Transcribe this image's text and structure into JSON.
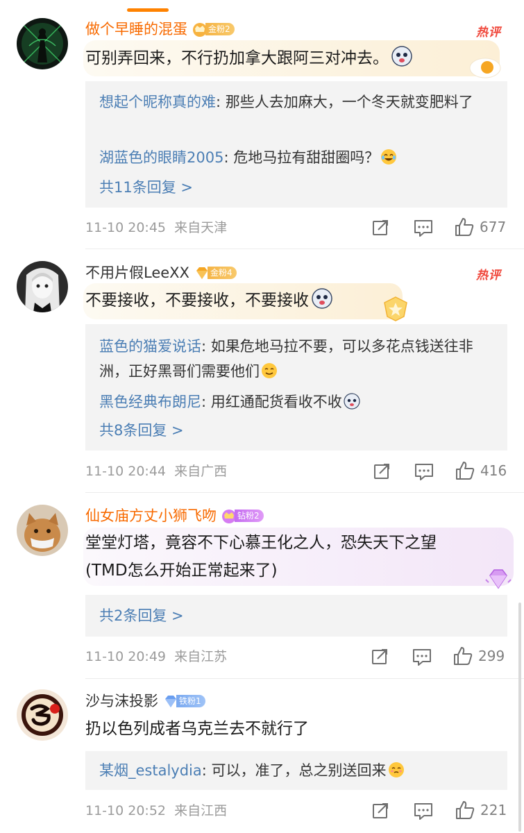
{
  "comments": [
    {
      "username": "做个早睡的混蛋",
      "badge": {
        "text": "金粉2",
        "type": "gold"
      },
      "hot_label": "热评",
      "text": "可别弄回来，不行扔加拿大跟阿三对冲去。",
      "replies": [
        {
          "user": "想起个昵称真的难",
          "text": ": 那些人去加麻大，一个冬天就变肥料了"
        },
        {
          "user": "湖蓝色的眼睛2005",
          "text": ": 危地马拉有甜甜圈吗？"
        }
      ],
      "more_replies": "共11条回复 >",
      "timestamp": "11-10 20:45",
      "location": "来自天津",
      "likes": "677"
    },
    {
      "username": "不用片假LeeXX",
      "badge": {
        "text": "金粉4",
        "type": "gold"
      },
      "hot_label": "热评",
      "text": "不要接收，不要接收，不要接收",
      "replies": [
        {
          "user": "蓝色的猫爱说话",
          "text": ": 如果危地马拉不要，可以多花点钱送往非洲，正好黑哥们需要他们"
        },
        {
          "user": "黑色经典布朗尼",
          "text": ": 用红通配货看收不收"
        }
      ],
      "more_replies": "共8条回复 >",
      "timestamp": "11-10 20:44",
      "location": "来自广西",
      "likes": "416"
    },
    {
      "username": "仙女庙方丈小狮飞吻",
      "badge": {
        "text": "钻粉2",
        "type": "diamond"
      },
      "text": "堂堂灯塔，竟容不下心慕王化之人，恐失天下之望(TMD怎么开始正常起来了)",
      "text_line1": "堂堂灯塔，竟容不下心慕王化之人，恐失天下之望",
      "text_line2": "(TMD怎么开始正常起来了)",
      "more_replies": "共2条回复 >",
      "timestamp": "11-10 20:49",
      "location": "来自江苏",
      "likes": "299"
    },
    {
      "username": "沙与沫投影",
      "badge": {
        "text": "铁粉1",
        "type": "iron"
      },
      "text": "扔以色列成者乌克兰去不就行了",
      "replies": [
        {
          "user": "某烟_estalydia",
          "text": ": 可以，准了，总之别送回来"
        }
      ],
      "timestamp": "11-10 20:52",
      "location": "来自江西",
      "likes": "221"
    }
  ],
  "icons": {
    "repost": "repost-icon",
    "comment": "comment-icon",
    "like": "like-icon"
  },
  "colors": {
    "vip_name": "#f86a00",
    "reply_user": "#4b7eb4",
    "hot": "#f0483c"
  }
}
